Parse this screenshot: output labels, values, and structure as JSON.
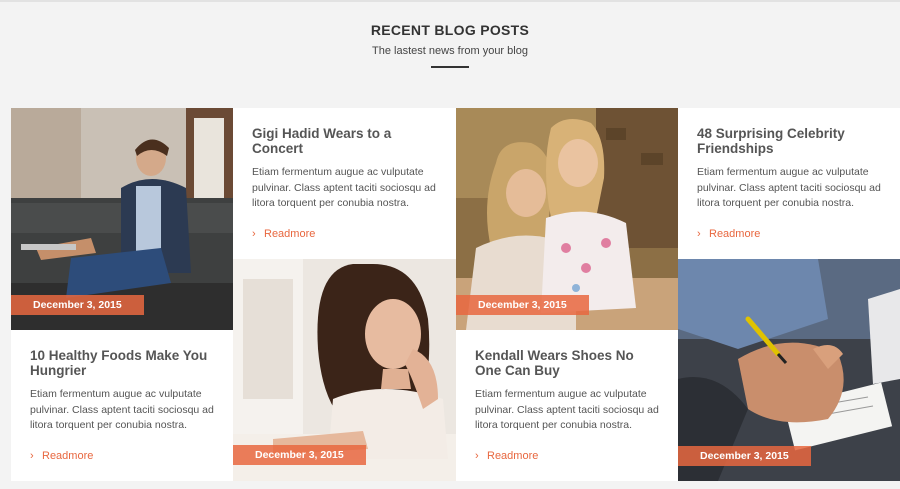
{
  "section": {
    "title": "RECENT BLOG POSTS",
    "subtitle": "The lastest news from your blog"
  },
  "posts": [
    {
      "title": "Gigi Hadid Wears to a Concert",
      "excerpt": "Etiam fermentum augue ac vulputate pulvinar. Class aptent taciti sociosqu ad litora torquent per conubia nostra.",
      "readmore": "Readmore"
    },
    {
      "title": "48 Surprising Celebrity Friendships",
      "excerpt": "Etiam fermentum augue ac vulputate pulvinar. Class aptent taciti sociosqu ad litora torquent per conubia nostra.",
      "readmore": "Readmore"
    },
    {
      "title": "10 Healthy Foods Make You Hungrier",
      "excerpt": "Etiam fermentum augue ac vulputate pulvinar. Class aptent taciti sociosqu ad litora torquent per conubia nostra.",
      "readmore": "Readmore"
    },
    {
      "title": "Kendall Wears Shoes No One Can Buy",
      "excerpt": "Etiam fermentum augue ac vulputate pulvinar. Class aptent taciti sociosqu ad litora torquent per conubia nostra.",
      "readmore": "Readmore"
    }
  ],
  "images": [
    {
      "date": "December 3, 2015",
      "icon": "man-on-sofa-photo"
    },
    {
      "date": "December 3, 2015",
      "icon": "smiling-woman-photo"
    },
    {
      "date": "December 3, 2015",
      "icon": "two-girls-photo"
    },
    {
      "date": "December 3, 2015",
      "icon": "hand-writing-photo"
    }
  ],
  "colors": {
    "accent": "#e8673f",
    "background": "#f3f3f3",
    "card": "#ffffff",
    "title_text": "#555555"
  }
}
